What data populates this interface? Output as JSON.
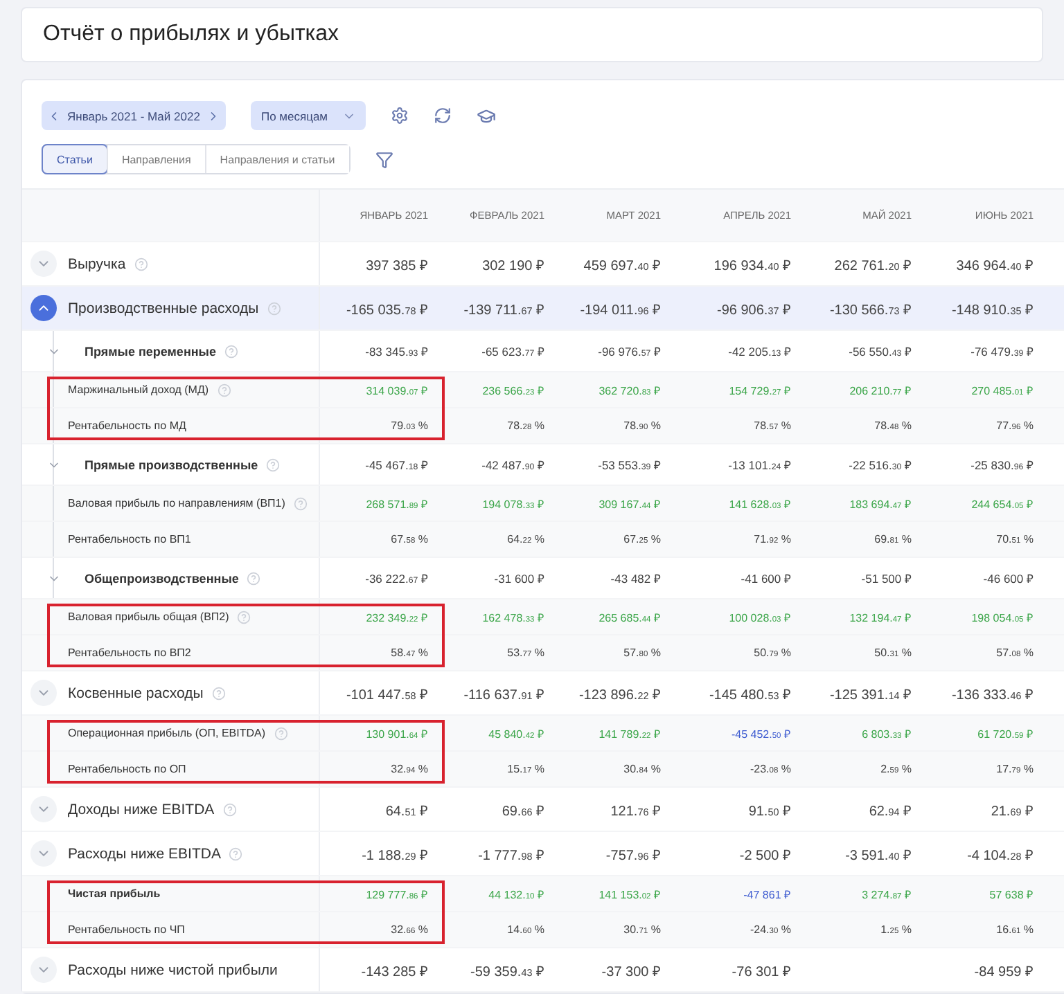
{
  "title": "Отчёт о прибылях и убытках",
  "toolbar": {
    "period": "Январь 2021 - Май 2022",
    "grouping": "По месяцам",
    "view_tabs": [
      {
        "label": "Статьи",
        "selected": true
      },
      {
        "label": "Направления",
        "selected": false
      },
      {
        "label": "Направления и статьи",
        "selected": false
      }
    ]
  },
  "table": {
    "columns": [
      "ЯНВАРЬ 2021",
      "ФЕВРАЛЬ 2021",
      "МАРТ 2021",
      "АПРЕЛЬ 2021",
      "МАЙ 2021",
      "ИЮНЬ 2021"
    ],
    "rows": [
      {
        "kind": "group",
        "label": "Выручка",
        "help": true,
        "expanded": false,
        "values": [
          {
            "text": "397 385 ₽"
          },
          {
            "text": "302 190 ₽"
          },
          {
            "text": "459 697.40 ₽"
          },
          {
            "text": "196 934.40 ₽"
          },
          {
            "text": "262 761.20 ₽"
          },
          {
            "text": "346 964.40 ₽"
          }
        ]
      },
      {
        "kind": "group",
        "label": "Производственные расходы",
        "help": true,
        "expanded": true,
        "values": [
          {
            "text": "-165 035.78 ₽"
          },
          {
            "text": "-139 711.67 ₽"
          },
          {
            "text": "-194 011.96 ₽"
          },
          {
            "text": "-96 906.37 ₽"
          },
          {
            "text": "-130 566.73 ₽"
          },
          {
            "text": "-148 910.35 ₽"
          }
        ],
        "children": [
          {
            "kind": "subgroup",
            "label": "Прямые переменные",
            "help": true,
            "values": [
              {
                "text": "-83 345.93 ₽"
              },
              {
                "text": "-65 623.77 ₽"
              },
              {
                "text": "-96 976.57 ₽"
              },
              {
                "text": "-42 205.13 ₽"
              },
              {
                "text": "-56 550.43 ₽"
              },
              {
                "text": "-76 479.39 ₽"
              }
            ],
            "children": [
              {
                "kind": "metric",
                "label": "Маржинальный доход (МД)",
                "help": true,
                "highlighted": true,
                "values": [
                  {
                    "text": "314 039.07 ₽",
                    "color": "#3aa548"
                  },
                  {
                    "text": "236 566.23 ₽",
                    "color": "#3aa548"
                  },
                  {
                    "text": "362 720.83 ₽",
                    "color": "#3aa548"
                  },
                  {
                    "text": "154 729.27 ₽",
                    "color": "#3aa548"
                  },
                  {
                    "text": "206 210.77 ₽",
                    "color": "#3aa548"
                  },
                  {
                    "text": "270 485.01 ₽",
                    "color": "#3aa548"
                  }
                ]
              },
              {
                "kind": "metric",
                "label": "Рентабельность по МД",
                "help": false,
                "highlighted": true,
                "values": [
                  {
                    "text": "79.03 %"
                  },
                  {
                    "text": "78.28 %"
                  },
                  {
                    "text": "78.90 %"
                  },
                  {
                    "text": "78.57 %"
                  },
                  {
                    "text": "78.48 %"
                  },
                  {
                    "text": "77.96 %"
                  }
                ]
              }
            ]
          },
          {
            "kind": "subgroup",
            "label": "Прямые производственные",
            "help": true,
            "values": [
              {
                "text": "-45 467.18 ₽"
              },
              {
                "text": "-42 487.90 ₽"
              },
              {
                "text": "-53 553.39 ₽"
              },
              {
                "text": "-13 101.24 ₽"
              },
              {
                "text": "-22 516.30 ₽"
              },
              {
                "text": "-25 830.96 ₽"
              }
            ],
            "children": [
              {
                "kind": "metric",
                "label": "Валовая прибыль по направлениям (ВП1)",
                "help": true,
                "highlighted": false,
                "values": [
                  {
                    "text": "268 571.89 ₽",
                    "color": "#3aa548"
                  },
                  {
                    "text": "194 078.33 ₽",
                    "color": "#3aa548"
                  },
                  {
                    "text": "309 167.44 ₽",
                    "color": "#3aa548"
                  },
                  {
                    "text": "141 628.03 ₽",
                    "color": "#3aa548"
                  },
                  {
                    "text": "183 694.47 ₽",
                    "color": "#3aa548"
                  },
                  {
                    "text": "244 654.05 ₽",
                    "color": "#3aa548"
                  }
                ]
              },
              {
                "kind": "metric",
                "label": "Рентабельность по ВП1",
                "help": false,
                "highlighted": false,
                "values": [
                  {
                    "text": "67.58 %"
                  },
                  {
                    "text": "64.22 %"
                  },
                  {
                    "text": "67.25 %"
                  },
                  {
                    "text": "71.92 %"
                  },
                  {
                    "text": "69.81 %"
                  },
                  {
                    "text": "70.51 %"
                  }
                ]
              }
            ]
          },
          {
            "kind": "subgroup",
            "label": "Общепроизводственные",
            "help": true,
            "values": [
              {
                "text": "-36 222.67 ₽"
              },
              {
                "text": "-31 600 ₽"
              },
              {
                "text": "-43 482 ₽"
              },
              {
                "text": "-41 600 ₽"
              },
              {
                "text": "-51 500 ₽"
              },
              {
                "text": "-46 600 ₽"
              }
            ]
          }
        ]
      },
      {
        "kind": "metric",
        "label": "Валовая прибыль общая (ВП2)",
        "help": true,
        "highlighted": true,
        "values": [
          {
            "text": "232 349.22 ₽",
            "color": "#3aa548"
          },
          {
            "text": "162 478.33 ₽",
            "color": "#3aa548"
          },
          {
            "text": "265 685.44 ₽",
            "color": "#3aa548"
          },
          {
            "text": "100 028.03 ₽",
            "color": "#3aa548"
          },
          {
            "text": "132 194.47 ₽",
            "color": "#3aa548"
          },
          {
            "text": "198 054.05 ₽",
            "color": "#3aa548"
          }
        ]
      },
      {
        "kind": "metric",
        "label": "Рентабельность по ВП2",
        "help": false,
        "highlighted": true,
        "values": [
          {
            "text": "58.47 %"
          },
          {
            "text": "53.77 %"
          },
          {
            "text": "57.80 %"
          },
          {
            "text": "50.79 %"
          },
          {
            "text": "50.31 %"
          },
          {
            "text": "57.08 %"
          }
        ]
      },
      {
        "kind": "group",
        "label": "Косвенные расходы",
        "help": true,
        "expanded": false,
        "values": [
          {
            "text": "-101 447.58 ₽"
          },
          {
            "text": "-116 637.91 ₽"
          },
          {
            "text": "-123 896.22 ₽"
          },
          {
            "text": "-145 480.53 ₽"
          },
          {
            "text": "-125 391.14 ₽"
          },
          {
            "text": "-136 333.46 ₽"
          }
        ]
      },
      {
        "kind": "metric",
        "label": "Операционная прибыль (ОП, EBITDA)",
        "help": true,
        "highlighted": true,
        "values": [
          {
            "text": "130 901.64 ₽",
            "color": "#3aa548"
          },
          {
            "text": "45 840.42 ₽",
            "color": "#3aa548"
          },
          {
            "text": "141 789.22 ₽",
            "color": "#3aa548"
          },
          {
            "text": "-45 452.50 ₽",
            "color": "#3d5bd0"
          },
          {
            "text": "6 803.33 ₽",
            "color": "#3aa548"
          },
          {
            "text": "61 720.59 ₽",
            "color": "#3aa548"
          }
        ]
      },
      {
        "kind": "metric",
        "label": "Рентабельность по ОП",
        "help": false,
        "highlighted": true,
        "values": [
          {
            "text": "32.94 %"
          },
          {
            "text": "15.17 %"
          },
          {
            "text": "30.84 %"
          },
          {
            "text": "-23.08 %"
          },
          {
            "text": "2.59 %"
          },
          {
            "text": "17.79 %"
          }
        ]
      },
      {
        "kind": "group",
        "label": "Доходы ниже EBITDA",
        "help": true,
        "expanded": false,
        "values": [
          {
            "text": "64.51 ₽"
          },
          {
            "text": "69.66 ₽"
          },
          {
            "text": "121.76 ₽"
          },
          {
            "text": "91.50 ₽"
          },
          {
            "text": "62.94 ₽"
          },
          {
            "text": "21.69 ₽"
          }
        ]
      },
      {
        "kind": "group",
        "label": "Расходы ниже EBITDA",
        "help": true,
        "expanded": false,
        "values": [
          {
            "text": "-1 188.29 ₽"
          },
          {
            "text": "-1 777.98 ₽"
          },
          {
            "text": "-757.96 ₽"
          },
          {
            "text": "-2 500 ₽"
          },
          {
            "text": "-3 591.40 ₽"
          },
          {
            "text": "-4 104.28 ₽"
          }
        ]
      },
      {
        "kind": "metric",
        "label": "Чистая прибыль",
        "help": false,
        "highlighted": true,
        "strong": true,
        "values": [
          {
            "text": "129 777.86 ₽",
            "color": "#3aa548"
          },
          {
            "text": "44 132.10 ₽",
            "color": "#3aa548"
          },
          {
            "text": "141 153.02 ₽",
            "color": "#3aa548"
          },
          {
            "text": "-47 861 ₽",
            "color": "#3d5bd0"
          },
          {
            "text": "3 274.87 ₽",
            "color": "#3aa548"
          },
          {
            "text": "57 638 ₽",
            "color": "#3aa548"
          }
        ]
      },
      {
        "kind": "metric",
        "label": "Рентабельность по ЧП",
        "help": false,
        "highlighted": true,
        "values": [
          {
            "text": "32.66 %"
          },
          {
            "text": "14.60 %"
          },
          {
            "text": "30.71 %"
          },
          {
            "text": "-24.30 %"
          },
          {
            "text": "1.25 %"
          },
          {
            "text": "16.61 %"
          }
        ]
      },
      {
        "kind": "group",
        "label": "Расходы ниже чистой прибыли",
        "help": false,
        "expanded": false,
        "values": [
          {
            "text": "-143 285 ₽"
          },
          {
            "text": "-59 359.43 ₽"
          },
          {
            "text": "-37 300 ₽"
          },
          {
            "text": "-76 301 ₽"
          },
          {
            "blank": true
          },
          {
            "text": "-84 959 ₽"
          }
        ]
      }
    ]
  }
}
